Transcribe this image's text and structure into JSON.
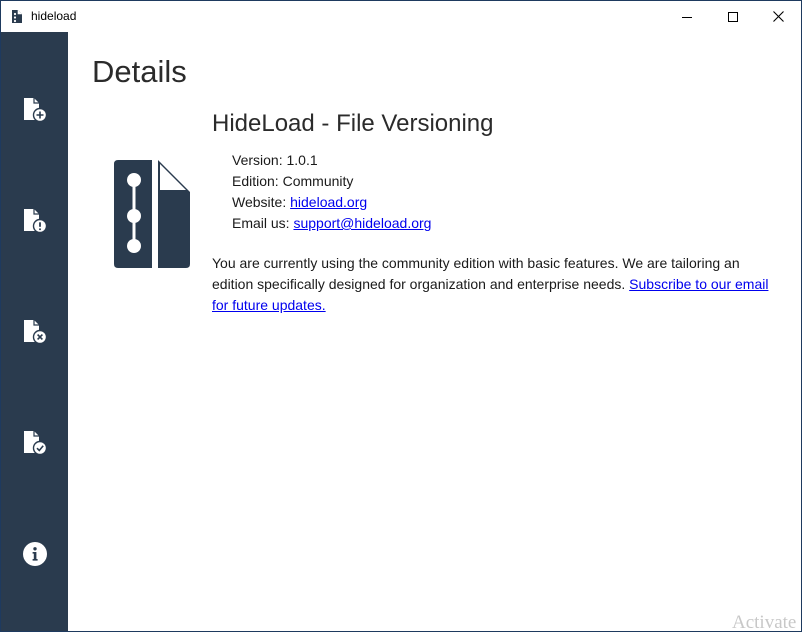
{
  "window": {
    "title": "hideload"
  },
  "sidebar": {
    "items": [
      {
        "name": "add-file",
        "icon": "file-plus-icon"
      },
      {
        "name": "warning-file",
        "icon": "file-alert-icon"
      },
      {
        "name": "removed-file",
        "icon": "file-x-icon"
      },
      {
        "name": "verified-file",
        "icon": "file-check-icon"
      },
      {
        "name": "info",
        "icon": "info-icon"
      }
    ]
  },
  "main": {
    "page_title": "Details",
    "product_name": "HideLoad - File Versioning",
    "version_label": "Version: ",
    "version_value": "1.0.1",
    "edition_label": "Edition: ",
    "edition_value": "Community",
    "website_label": "Website: ",
    "website_link": "hideload.org",
    "email_label": "Email us: ",
    "email_link": "support@hideload.org",
    "description": "You are currently using the community edition with basic features. We are tailoring an edition specifically designed for organization and enterprise needs. ",
    "subscribe_link": "Subscribe to our email for future updates."
  },
  "watermark": "Activate",
  "colors": {
    "sidebar_bg": "#2a3b4e",
    "link": "#0000ee",
    "logo": "#2a3b4e"
  }
}
